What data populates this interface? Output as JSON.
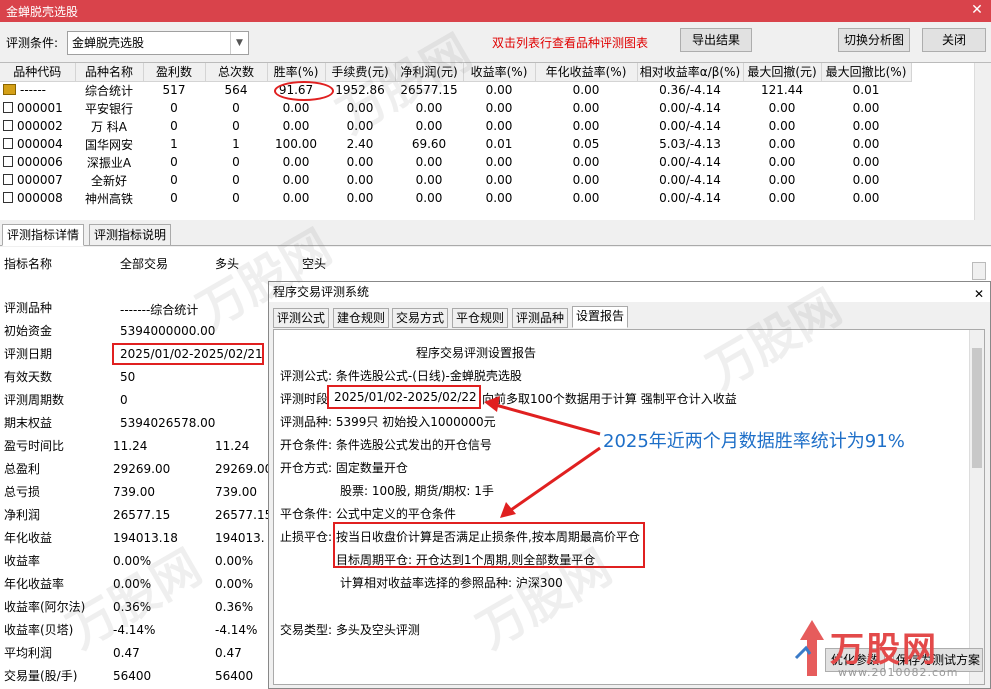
{
  "window": {
    "title": "金蝉脱壳选股",
    "close": "✕"
  },
  "toolbar": {
    "condition_label": "评测条件:",
    "condition_value": "金蝉脱壳选股",
    "hint": "双击列表行查看品种评测图表",
    "export_label": "导出结果",
    "switch_label": "切换分析图",
    "close_label": "关闭"
  },
  "table": {
    "columns": [
      "品种代码",
      "品种名称",
      "盈利数",
      "总次数",
      "胜率(%)",
      "手续费(元)",
      "净利润(元)",
      "收益率(%)",
      "年化收益率(%)",
      "相对收益率α/β(%)",
      "最大回撤(元)",
      "最大回撤比(%)"
    ],
    "rows": [
      [
        "------",
        "综合统计",
        "517",
        "564",
        "91.67",
        "1952.86",
        "26577.15",
        "0.00",
        "0.00",
        "0.36/-4.14",
        "121.44",
        "0.01"
      ],
      [
        "000001",
        "平安银行",
        "0",
        "0",
        "0.00",
        "0.00",
        "0.00",
        "0.00",
        "0.00",
        "0.00/-4.14",
        "0.00",
        "0.00"
      ],
      [
        "000002",
        "万 科A",
        "0",
        "0",
        "0.00",
        "0.00",
        "0.00",
        "0.00",
        "0.00",
        "0.00/-4.14",
        "0.00",
        "0.00"
      ],
      [
        "000004",
        "国华网安",
        "1",
        "1",
        "100.00",
        "2.40",
        "69.60",
        "0.01",
        "0.05",
        "5.03/-4.13",
        "0.00",
        "0.00"
      ],
      [
        "000006",
        "深振业A",
        "0",
        "0",
        "0.00",
        "0.00",
        "0.00",
        "0.00",
        "0.00",
        "0.00/-4.14",
        "0.00",
        "0.00"
      ],
      [
        "000007",
        "全新好",
        "0",
        "0",
        "0.00",
        "0.00",
        "0.00",
        "0.00",
        "0.00",
        "0.00/-4.14",
        "0.00",
        "0.00"
      ],
      [
        "000008",
        "神州高铁",
        "0",
        "0",
        "0.00",
        "0.00",
        "0.00",
        "0.00",
        "0.00",
        "0.00/-4.14",
        "0.00",
        "0.00"
      ]
    ]
  },
  "lower_tabs": {
    "detail": "评测指标详情",
    "explain": "评测指标说明"
  },
  "metrics_header": {
    "name": "指标名称",
    "all": "全部交易",
    "long": "多头",
    "short": "空头"
  },
  "metrics": [
    {
      "label": "评测品种",
      "v1": "-------综合统计",
      "v2": ""
    },
    {
      "label": "初始资金",
      "v1": "5394000000.00",
      "v2": ""
    },
    {
      "label": "评测日期",
      "v1": "2025/01/02-2025/02/21",
      "v2": ""
    },
    {
      "label": "有效天数",
      "v1": "50",
      "v2": ""
    },
    {
      "label": "评测周期数",
      "v1": "0",
      "v2": ""
    },
    {
      "label": "期末权益",
      "v1": "5394026578.00",
      "v2": ""
    },
    {
      "label": "盈亏时间比",
      "v1": "11.24",
      "v2": "11.24"
    },
    {
      "label": "总盈利",
      "v1": "29269.00",
      "v2": "29269.00"
    },
    {
      "label": "总亏损",
      "v1": "739.00",
      "v2": "739.00"
    },
    {
      "label": "净利润",
      "v1": "26577.15",
      "v2": "26577.15"
    },
    {
      "label": "年化收益",
      "v1": "194013.18",
      "v2": "194013."
    },
    {
      "label": "收益率",
      "v1": "0.00%",
      "v2": "0.00%"
    },
    {
      "label": "年化收益率",
      "v1": "0.00%",
      "v2": "0.00%"
    },
    {
      "label": "收益率(阿尔法)",
      "v1": "0.36%",
      "v2": "0.36%"
    },
    {
      "label": "收益率(贝塔)",
      "v1": "-4.14%",
      "v2": "-4.14%"
    },
    {
      "label": "平均利润",
      "v1": "0.47",
      "v2": "0.47"
    },
    {
      "label": "交易量(股/手)",
      "v1": "56400",
      "v2": "56400"
    }
  ],
  "dialog": {
    "title": "程序交易评测系统",
    "close": "✕",
    "tabs": [
      "评测公式",
      "建仓规则",
      "交易方式",
      "平仓规则",
      "评测品种",
      "设置报告"
    ],
    "report_title": "程序交易评测设置报告",
    "lines": {
      "formula": "评测公式:  条件选股公式-(日线)-金蝉脱壳选股",
      "period_label": "评测时段",
      "period_value": "2025/01/02-2025/02/22",
      "period_note": "向前多取100个数据用于计算 强制平仓计入收益",
      "variety": "评测品种:  5399只 初始投入1000000元",
      "open_cond": "开仓条件:  条件选股公式发出的开仓信号",
      "open_mode": "开仓方式:  固定数量开仓",
      "shares": "股票: 100股, 期货/期权: 1手",
      "close_cond": "平仓条件:  公式中定义的平仓条件",
      "stop_label": "止损平仓:",
      "stop_1": "按当日收盘价计算是否满足止损条件,按本周期最高价平仓",
      "stop_2": "目标周期平仓: 开仓达到1个周期,则全部数量平仓",
      "benchmark": "计算相对收益率选择的参照品种: 沪深300",
      "trade_type": "交易类型:  多头及空头评测"
    },
    "btn_optimize": "优化参数",
    "btn_save": "保存为测试方案"
  },
  "annotation": "2025年近两个月数据胜率统计为91%",
  "watermark": {
    "brand": "万股网",
    "url": "www.2010082.com",
    "faint": "万股网"
  },
  "colors": {
    "titlebar": "#d9434b",
    "hint": "#e00000",
    "callout": "#1e6fc8",
    "highlight": "#e02020"
  }
}
